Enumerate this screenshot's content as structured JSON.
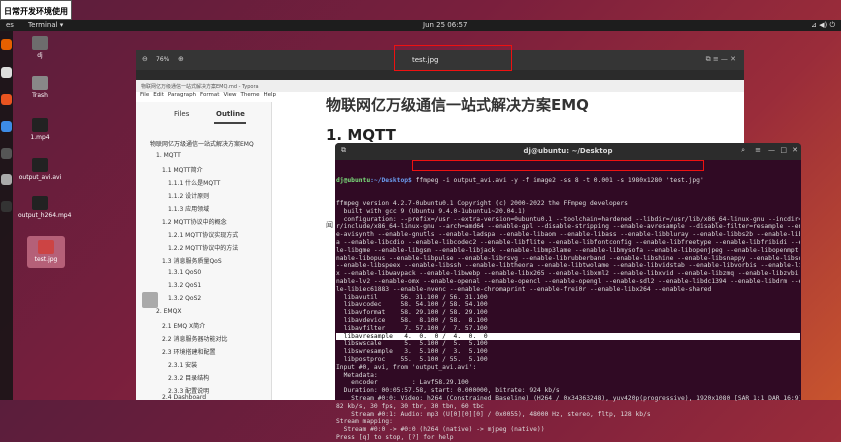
{
  "window_title": "日常开发环境使用",
  "topbar": {
    "activities": "es",
    "app": "Terminal ▾",
    "clock": "Jun 25  06:57",
    "tray": "⊿ ◀) ⏻"
  },
  "desktop": [
    {
      "label": "dj"
    },
    {
      "label": "Trash"
    },
    {
      "label": "1.mp4"
    },
    {
      "label": "output_avi.avi"
    },
    {
      "label": "output_h264.mp4"
    },
    {
      "label": "test.jpg"
    }
  ],
  "viewer": {
    "zoom": "76%",
    "title": "test.jpg"
  },
  "typora": {
    "titlebar": "物联网亿万级通信一站式解决方案EMQ.md - Typora",
    "menu": [
      "File",
      "Edit",
      "Paragraph",
      "Format",
      "View",
      "Theme",
      "Help"
    ],
    "tabs": [
      "Files",
      "Outline"
    ],
    "toc": [
      "物联网亿万级通信一站式解决方案EMQ",
      "1. MQTT",
      "1.1 MQTT简介",
      "1.1.1 什么是MQTT",
      "1.1.2 设计原则",
      "1.1.3 应用领域",
      "1.2 MQTT协议中的概念",
      "1.2.1 MQTT协议实现方式",
      "1.2.2 MQTT协议中的方法",
      "1.3 消息服务质量QoS",
      "1.3.1 QoS0",
      "1.3.2 QoS1",
      "1.3.2 QoS2",
      "2. EMQX",
      "2.1 EMQ X简介",
      "2.2 消息服务器功能对比",
      "2.3 环境搭建和配置",
      "2.3.1 安装",
      "2.3.2 目录结构",
      "2.3.3 配置说明",
      "2.4 Dashboard"
    ],
    "doc_heading_top": "物联网亿万级通信一站式解决方案EMQ",
    "doc_h1": "1. MQTT",
    "doc_frag": "闻"
  },
  "terminal": {
    "title": "dj@ubuntu: ~/Desktop",
    "prompt_user": "dj@ubuntu",
    "prompt_path": ":~/Desktop$",
    "command": " ffmpeg -i output_avi.avi -y -f image2 -ss 8 -t 0.001 -s 1980x1280 'test.jpg'",
    "lines": [
      "ffmpeg version 4.2.7-0ubuntu0.1 Copyright (c) 2000-2022 the FFmpeg developers",
      "  built with gcc 9 (Ubuntu 9.4.0-1ubuntu1~20.04.1)",
      "  configuration: --prefix=/usr --extra-version=0ubuntu0.1 --toolchain=hardened --libdir=/usr/lib/x86_64-linux-gnu --incdir=/us",
      "r/include/x86_64-linux-gnu --arch=amd64 --enable-gpl --disable-stripping --enable-avresample --disable-filter=resample --enabl",
      "e-avisynth --enable-gnutls --enable-ladspa --enable-libaom --enable-libass --enable-libbluray --enable-libbs2b --enable-libcaca",
      "a --enable-libcdio --enable-libcodec2 --enable-libflite --enable-libfontconfig --enable-libfreetype --enable-libfribidi --enab",
      "le-libgme --enable-libgsm --enable-libjack --enable-libmp3lame --enable-libmysofa --enable-libopenjpeg --enable-libopenmpt --e",
      "nable-libopus --enable-libpulse --enable-librsvg --enable-librubberband --enable-libshine --enable-libsnappy --enable-libsoxr",
      "--enable-libspeex --enable-libssh --enable-libtheora --enable-libtwolame --enable-libvidstab --enable-libvorbis --enable-libvp",
      "x --enable-libwavpack --enable-libwebp --enable-libx265 --enable-libxml2 --enable-libxvid --enable-libzmq --enable-libzvbi --e",
      "nable-lv2 --enable-omx --enable-openal --enable-opencl --enable-opengl --enable-sdl2 --enable-libdc1394 --enable-libdrm --enab",
      "le-libiec61883 --enable-nvenc --enable-chromaprint --enable-frei0r --enable-libx264 --enable-shared",
      "  libavutil      56. 31.100 / 56. 31.100",
      "  libavcodec     58. 54.100 / 58. 54.100",
      "  libavformat    58. 29.100 / 58. 29.100",
      "  libavdevice    58.  8.100 / 58.  8.100",
      "  libavfilter     7. 57.100 /  7. 57.100",
      "  libavresample   4.  0.  0 /  4.  0.  0",
      "  libswscale      5.  5.100 /  5.  5.100",
      "  libswresample   3.  5.100 /  3.  5.100",
      "  libpostproc    55.  5.100 / 55.  5.100",
      "Input #0, avi, from 'output_avi.avi':",
      "  Metadata:",
      "    encoder         : Lavf58.29.100",
      "  Duration: 00:05:57.58, start: 0.000000, bitrate: 924 kb/s",
      "    Stream #0:0: Video: h264 (Constrained Baseline) (H264 / 0x34363248), yuv420p(progressive), 1920x1080 [SAR 1:1 DAR 16:9], 7",
      "82 kb/s, 30 fps, 30 tbr, 30 tbn, 60 tbc",
      "    Stream #0:1: Audio: mp3 (U[0][0][0] / 0x0055), 48000 Hz, stereo, fltp, 128 kb/s",
      "Stream mapping:",
      "  Stream #0:0 -> #0:0 (h264 (native) -> mjpeg (native))",
      "Press [q] to stop, [?] for help"
    ],
    "selected_line_index": 17
  }
}
